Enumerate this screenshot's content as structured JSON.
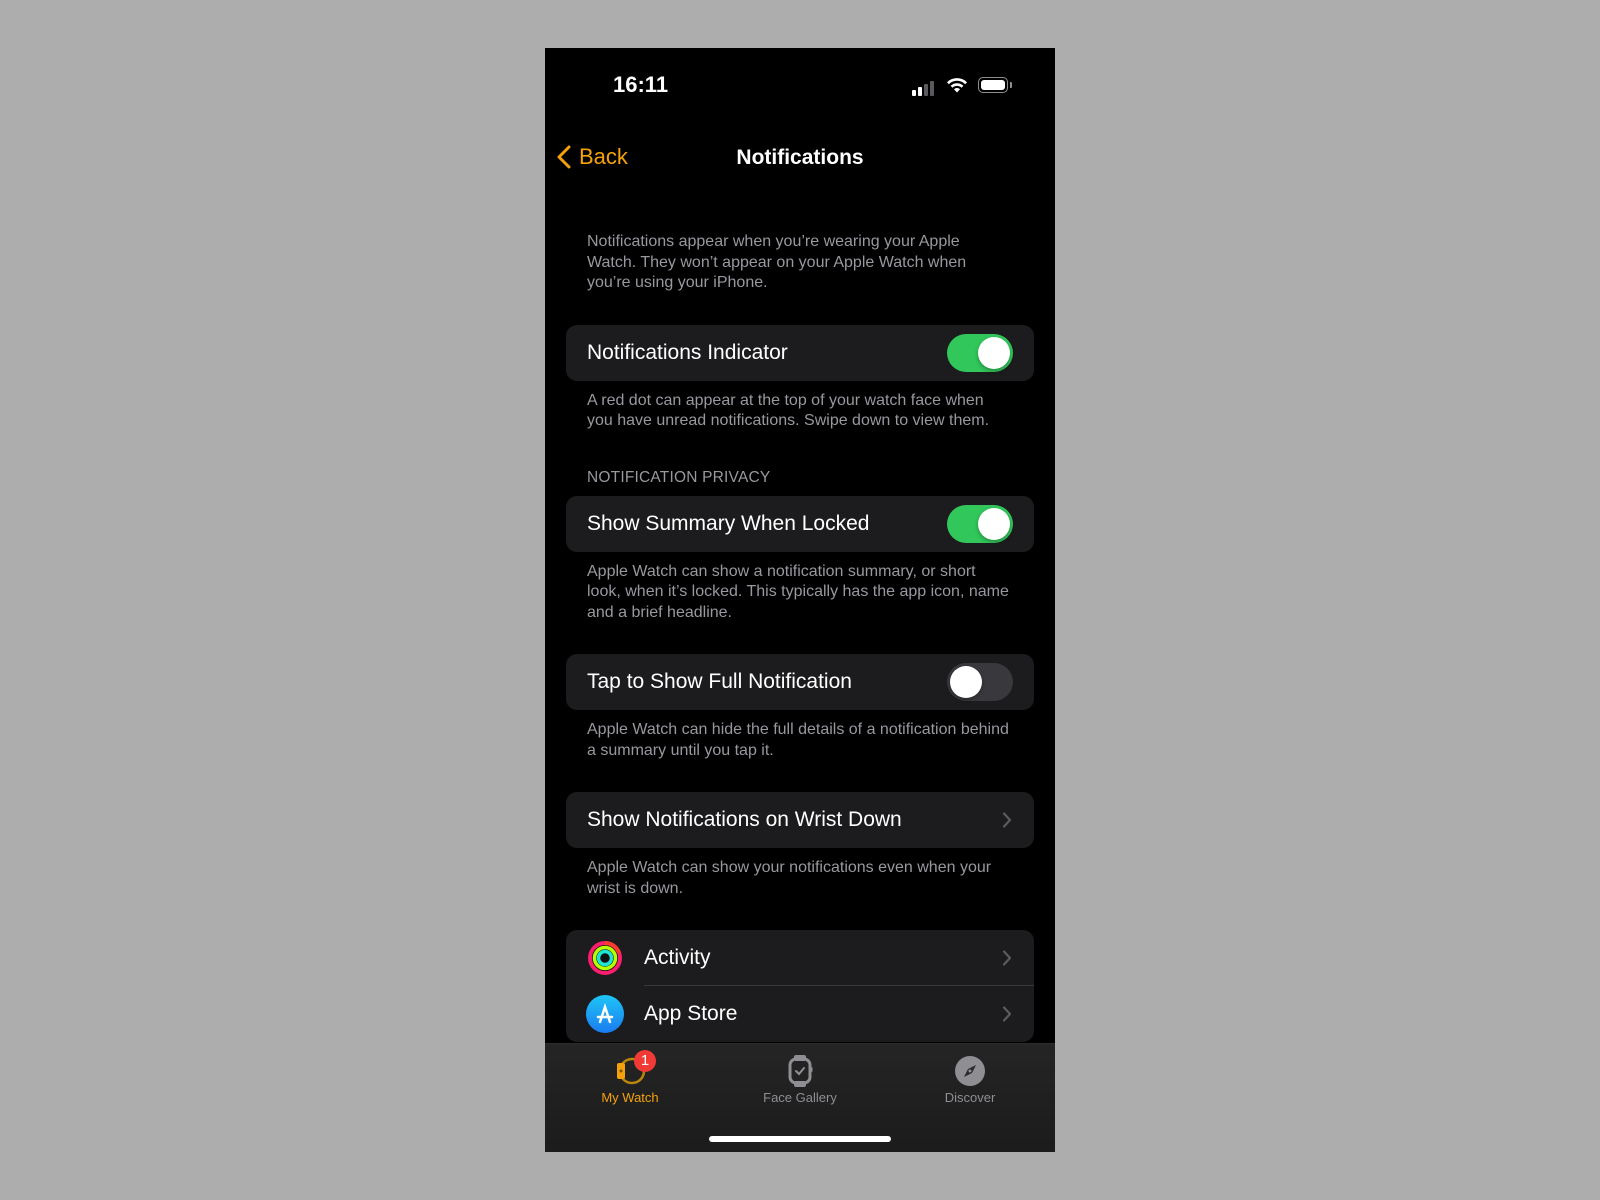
{
  "status_bar": {
    "time": "16:11",
    "signal_icon": "cellular-signal-icon",
    "wifi_icon": "wifi-icon",
    "battery_icon": "battery-icon"
  },
  "nav": {
    "back_label": "Back",
    "title": "Notifications"
  },
  "intro_text": "Notifications appear when you’re wearing your Apple Watch. They won’t appear on your Apple Watch when you’re using your iPhone.",
  "settings": [
    {
      "label": "Notifications Indicator",
      "type": "toggle",
      "value": true,
      "footer": "A red dot can appear at the top of your watch face when you have unread notifications. Swipe down to view them."
    },
    {
      "section_header": "Notification Privacy",
      "label": "Show Summary When Locked",
      "type": "toggle",
      "value": true,
      "footer": "Apple Watch can show a notification summary, or short look, when it’s locked. This typically has the app icon, name and a brief headline."
    },
    {
      "label": "Tap to Show Full Notification",
      "type": "toggle",
      "value": false,
      "footer": "Apple Watch can hide the full details of a notification behind a summary until you tap it."
    },
    {
      "label": "Show Notifications on Wrist Down",
      "type": "disclosure",
      "footer": "Apple Watch can show your notifications even when your wrist is down."
    }
  ],
  "apps": [
    {
      "label": "Activity",
      "icon": "activity-rings-icon"
    },
    {
      "label": "App Store",
      "icon": "app-store-icon"
    }
  ],
  "tabbar": {
    "tabs": [
      {
        "label": "My Watch",
        "icon": "watch-icon",
        "active": true,
        "badge": "1"
      },
      {
        "label": "Face Gallery",
        "icon": "watch-face-icon",
        "active": false
      },
      {
        "label": "Discover",
        "icon": "compass-icon",
        "active": false
      }
    ]
  },
  "colors": {
    "accent": "#f5a20a",
    "toggle_on": "#32c75a",
    "badge": "#f03a35"
  }
}
